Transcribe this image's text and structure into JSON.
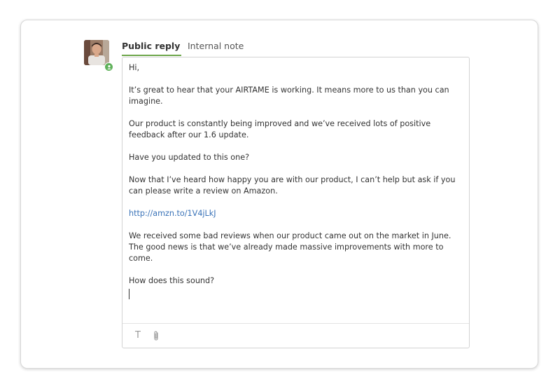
{
  "tabs": {
    "public_reply": "Public reply",
    "internal_note": "Internal note"
  },
  "message": {
    "greeting": "Hi,",
    "paragraph1": "It’s great to hear that your AIRTAME is working. It means more to us than you can imagine.",
    "paragraph2": "Our product is constantly being improved and we’ve received lots of positive feedback after our 1.6 update.",
    "paragraph3": "Have you updated to this one?",
    "paragraph4": "Now that I’ve heard how happy you are with our product, I can’t help but ask if you can please write a review on Amazon.",
    "link": "http://amzn.to/1V4jLkJ",
    "paragraph5": "We received some bad reviews when our product came out on the market in June. The good news is that we’ve already made massive improvements with more to come.",
    "closing": "How does this sound?"
  },
  "toolbar": {
    "text_format_glyph": "T",
    "icons": [
      "text-format-icon",
      "attachment-icon"
    ]
  },
  "colors": {
    "active_tab_underline": "#6da64a",
    "status_online": "#5fb15a",
    "link": "#3a73b8"
  }
}
